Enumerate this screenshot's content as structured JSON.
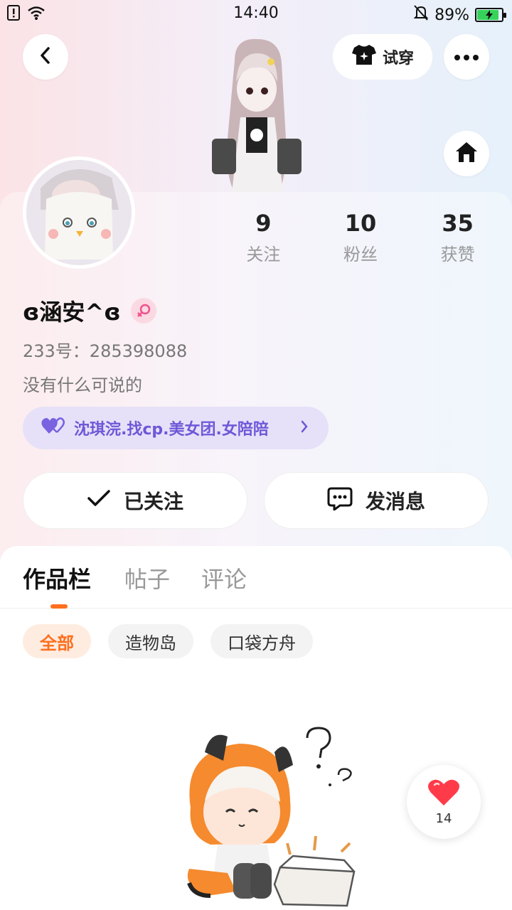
{
  "status_bar": {
    "time": "14:40",
    "battery": "89%",
    "battery_level": 0.89
  },
  "header": {
    "try_on_label": "试穿"
  },
  "profile": {
    "username": "ɞ涵安^ɞ",
    "uid": "233号：285398088",
    "bio": "没有什么可说的",
    "club_tag": "沈琪浣.找cp.美女团.女陪陪"
  },
  "stats": [
    {
      "value": "9",
      "label": "关注"
    },
    {
      "value": "10",
      "label": "粉丝"
    },
    {
      "value": "35",
      "label": "获赞"
    }
  ],
  "actions": {
    "follow_label": "已关注",
    "message_label": "发消息"
  },
  "tabs": [
    {
      "label": "作品栏",
      "active": true
    },
    {
      "label": "帖子",
      "active": false
    },
    {
      "label": "评论",
      "active": false
    }
  ],
  "filters": [
    {
      "label": "全部",
      "active": true
    },
    {
      "label": "造物岛",
      "active": false
    },
    {
      "label": "口袋方舟",
      "active": false
    }
  ],
  "like_fab": {
    "count": "14"
  },
  "colors": {
    "accent": "#ff6f1e",
    "club_purple": "#6e58d8",
    "heart_red": "#ff3b4a"
  }
}
